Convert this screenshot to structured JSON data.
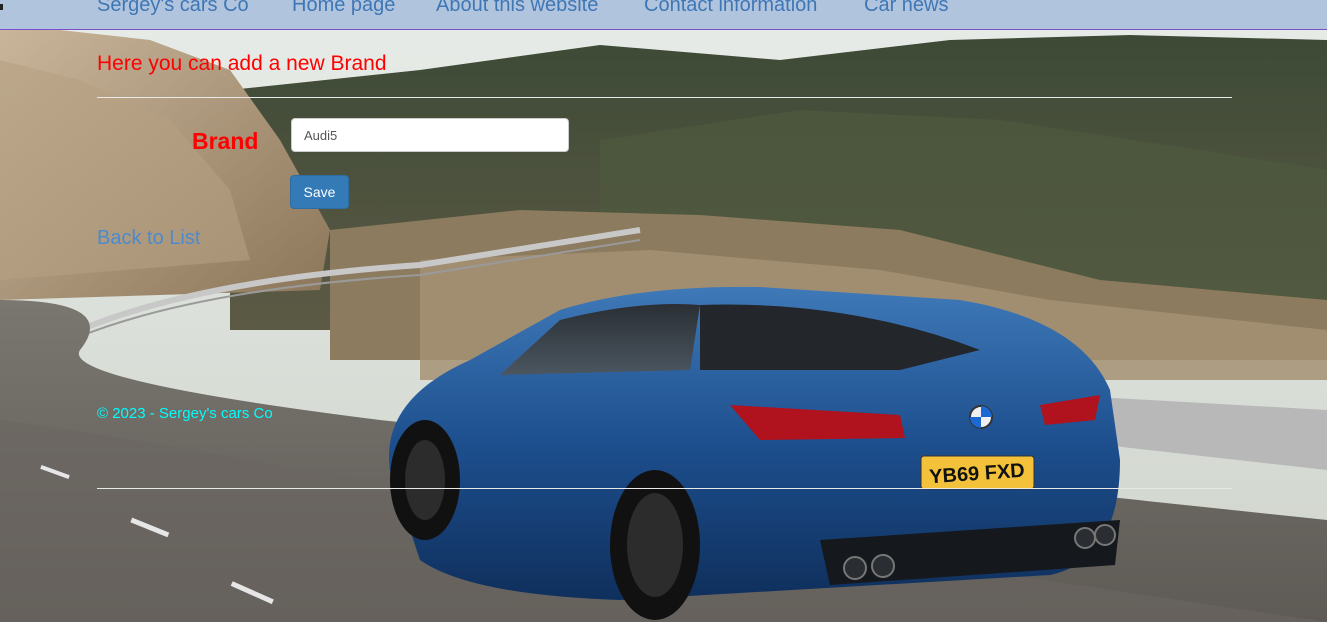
{
  "nav": {
    "brand": "Sergey's cars Co",
    "items": [
      {
        "label": "Home page"
      },
      {
        "label": "About this website"
      },
      {
        "label": "Contact information"
      },
      {
        "label": "Car news"
      }
    ]
  },
  "main": {
    "heading": "Here you can add a new Brand",
    "form": {
      "brand_label": "Brand",
      "brand_value": "Audi5",
      "save_label": "Save"
    },
    "back_link": "Back to List"
  },
  "footer": {
    "text": "© 2023 - Sergey's cars Co"
  },
  "background": {
    "description_icon": "car-road-photo",
    "plate_text": "YB69 FXD"
  },
  "colors": {
    "navbar_bg": "#b0c4de",
    "nav_link": "#3f77b5",
    "heading": "#ff0000",
    "button": "#337ab7",
    "footer": "#00ffff"
  }
}
